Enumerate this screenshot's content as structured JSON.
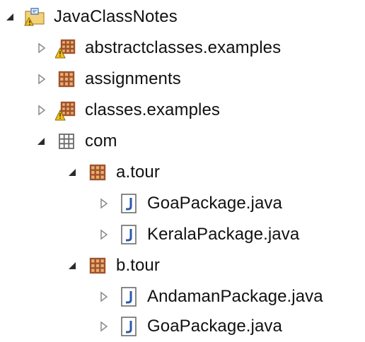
{
  "tree": {
    "project": {
      "label": "JavaClassNotes",
      "icon": "java-project-icon",
      "expanded": true
    },
    "items": [
      {
        "label": "abstractclasses.examples",
        "icon": "package-warning-icon",
        "expanded": false
      },
      {
        "label": "assignments",
        "icon": "package-icon",
        "expanded": false
      },
      {
        "label": "classes.examples",
        "icon": "package-warning-icon",
        "expanded": false
      },
      {
        "label": "com",
        "icon": "empty-package-icon",
        "expanded": true
      },
      {
        "label": "a.tour",
        "icon": "package-icon",
        "expanded": true
      },
      {
        "label": "GoaPackage.java",
        "icon": "java-file-icon",
        "expanded": false
      },
      {
        "label": "KeralaPackage.java",
        "icon": "java-file-icon",
        "expanded": false
      },
      {
        "label": "b.tour",
        "icon": "package-icon",
        "expanded": true
      },
      {
        "label": "AndamanPackage.java",
        "icon": "java-file-icon",
        "expanded": false
      },
      {
        "label": "GoaPackage.java",
        "icon": "java-file-icon",
        "expanded": false
      }
    ]
  },
  "colors": {
    "package_brown": "#a0522d",
    "package_fill": "#e8b070",
    "warning_yellow": "#f0c020",
    "java_blue": "#2a5aa8",
    "toggle_gray": "#8a8a8a",
    "toggle_dark": "#2a2a2a"
  }
}
